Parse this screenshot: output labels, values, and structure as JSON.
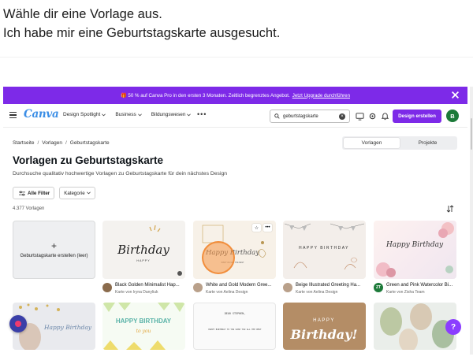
{
  "instruction": {
    "line1": "Wähle dir eine Vorlage aus.",
    "line2": "Ich habe mir eine Geburtstagskarte ausgesucht."
  },
  "promo": {
    "text": "🎁 50 % auf Canva Pro in den ersten 3 Monaten. Zeitlich begrenztes Angebot.",
    "link": "Jetzt Upgrade durchführen"
  },
  "nav": {
    "logo": "Canva",
    "links": [
      "Design Spotlight",
      "Business",
      "Bildungswesen"
    ],
    "search_value": "geburtstagskarte",
    "cta": "Design erstellen",
    "avatar_initial": "B"
  },
  "breadcrumb": [
    "Startseite",
    "Vorlagen",
    "Geburtstagskarte"
  ],
  "tabs": [
    "Vorlagen",
    "Projekte"
  ],
  "page": {
    "title": "Vorlagen zu Geburtstagskarte",
    "subtitle": "Durchsuche qualitativ hochwertige Vorlagen zu Geburtstagskarte für dein nächstes Design",
    "all_filters": "Alle Filter",
    "category": "Kategorie",
    "count": "4.377 Vorlagen"
  },
  "create_card": {
    "label": "Geburtstagskarte erstellen (leer)"
  },
  "templates": [
    {
      "name": "Black Golden Minimalist Hap...",
      "by": "Karte von Iryna Danyliuk",
      "art": "Birthday",
      "art_sub": "HAPPY"
    },
    {
      "name": "White and Gold Modern Gree...",
      "by": "Karte von Aelina Design",
      "art": "Happy Birthday",
      "art_sub": "WISH YOU ALL THE BEST"
    },
    {
      "name": "Beige Illustrated Greeting Ha...",
      "by": "Karte von Aelina Design",
      "art": "HAPPY BIRTHDAY",
      "art_sub": ""
    },
    {
      "name": "Green and Pink Watercolor Bi...",
      "by": "Karte von Zisha Team",
      "art": "Happy Birthday",
      "art_sub": "",
      "avatar": "ZT"
    }
  ],
  "row2": [
    {
      "art": "Happy Birthday"
    },
    {
      "art": "HAPPY BIRTHDAY",
      "art_sub": "to you"
    },
    {
      "art": "DEAR STEPHEN,",
      "art_sub": "HAPPY BIRTHDAY TO YOU WISH YOU ALL THE BEST"
    },
    {
      "art": "HAPPY",
      "art_sub": "Birthday!"
    },
    {
      "art": ""
    }
  ],
  "colors": {
    "brand_purple": "#7d2ae8",
    "logo_blue": "#3b8ee6",
    "avatar_green": "#1c7a39"
  },
  "fab_help": "?"
}
